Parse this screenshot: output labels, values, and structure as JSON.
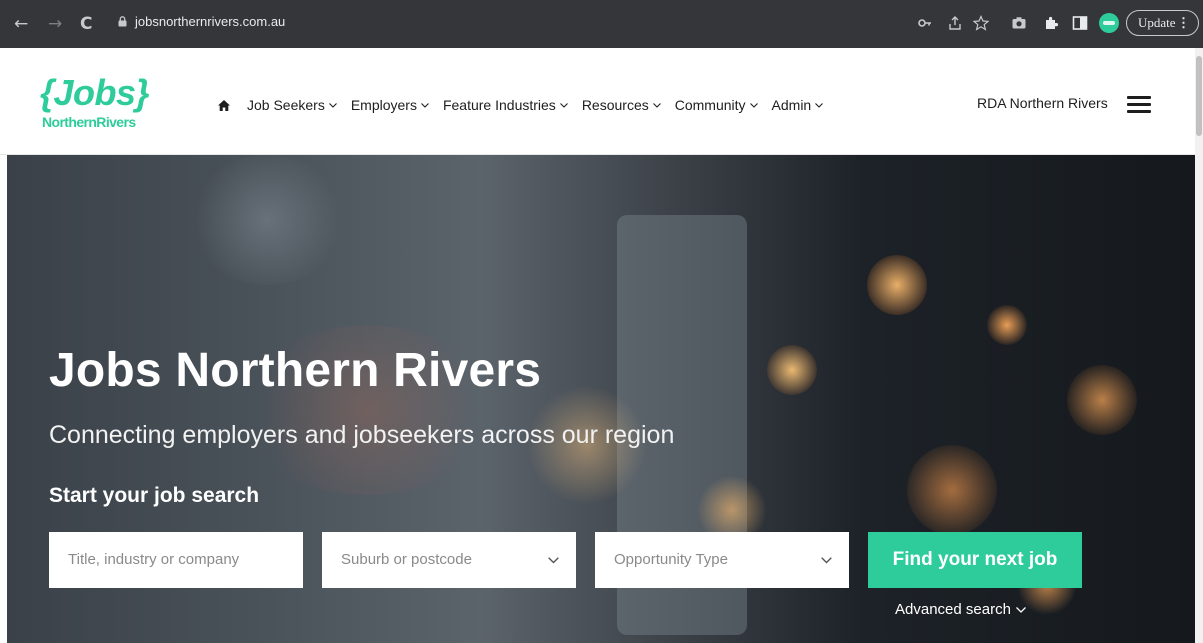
{
  "browser": {
    "url": "jobsnorthernrivers.com.au",
    "update_label": "Update"
  },
  "site": {
    "logo": {
      "word": "Jobs",
      "sub": "NorthernRivers"
    },
    "nav": [
      {
        "label": "Job Seekers"
      },
      {
        "label": "Employers"
      },
      {
        "label": "Feature Industries"
      },
      {
        "label": "Resources"
      },
      {
        "label": "Community"
      },
      {
        "label": "Admin"
      }
    ],
    "rda_label": "RDA Northern Rivers"
  },
  "hero": {
    "title": "Jobs Northern Rivers",
    "subtitle": "Connecting employers and jobseekers across our region",
    "search_heading": "Start your job search",
    "search": {
      "keyword_placeholder": "Title, industry or company",
      "location_placeholder": "Suburb or postcode",
      "type_placeholder": "Opportunity Type",
      "submit_label": "Find your next job",
      "advanced_label": "Advanced search"
    }
  },
  "colors": {
    "brand_green": "#2ecc9a",
    "chrome_bg": "#35363a",
    "nav_text": "#1e1e1e"
  },
  "icons": [
    "back-arrow-icon",
    "forward-arrow-icon",
    "reload-icon",
    "lock-icon",
    "key-icon",
    "share-icon",
    "star-icon",
    "camera-icon",
    "extensions-icon",
    "sidepanel-icon",
    "profile-icon",
    "home-icon",
    "chevron-down-icon",
    "hamburger-menu-icon"
  ]
}
